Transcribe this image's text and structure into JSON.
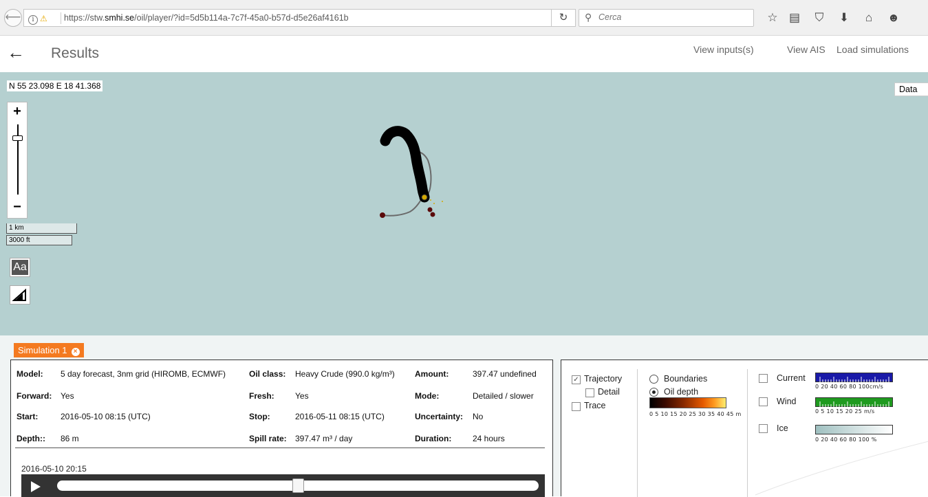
{
  "browser": {
    "url_prefix": "https://stw.",
    "url_domain": "smhi.se",
    "url_path": "/oil/player/?id=5d5b114a-7c7f-45a0-b57d-d5e26af4161b",
    "search_placeholder": "Cerca",
    "icons": [
      "back-icon",
      "info-icon",
      "warning-lock-icon",
      "reload-icon",
      "search-icon",
      "star-icon",
      "reading-list-icon",
      "pocket-icon",
      "download-icon",
      "home-icon",
      "smiley-icon"
    ]
  },
  "header": {
    "title": "Results",
    "links": [
      "View inputs(s)",
      "View AIS",
      "Load simulations"
    ]
  },
  "map": {
    "coordinates": "N 55 23.098 E 18 41.368",
    "zoom_in": "+",
    "zoom_out": "−",
    "scale_km": "1 km",
    "scale_ft": "3000 ft",
    "font_tool": "Aa",
    "data_dropdown": "Data"
  },
  "simulation": {
    "tab_label": "Simulation 1",
    "close": "×",
    "rows": [
      [
        {
          "label": "Model:",
          "value": "5 day forecast, 3nm grid (HIROMB, ECMWF)"
        },
        {
          "label": "Oil class:",
          "value": "Heavy Crude (990.0 kg/m³)"
        },
        {
          "label": "Amount:",
          "value": "397.47 undefined"
        }
      ],
      [
        {
          "label": "Forward:",
          "value": "Yes"
        },
        {
          "label": "Fresh:",
          "value": "Yes"
        },
        {
          "label": "Mode:",
          "value": "Detailed / slower"
        }
      ],
      [
        {
          "label": "Start:",
          "value": "2016-05-10 08:15 (UTC)"
        },
        {
          "label": "Stop:",
          "value": "2016-05-11 08:15 (UTC)"
        },
        {
          "label": "Uncertainty:",
          "value": "No"
        }
      ],
      [
        {
          "label": "Depth::",
          "value": "86 m"
        },
        {
          "label": "Spill rate:",
          "value": "397.47 m³ / day"
        },
        {
          "label": "Duration:",
          "value": "24 hours"
        }
      ]
    ],
    "current_time": "2016-05-10 20:15",
    "slider_position": 0.5
  },
  "layers": {
    "trajectory": {
      "label": "Trajectory",
      "checked": true
    },
    "detail": {
      "label": "Detail",
      "checked": false
    },
    "trace": {
      "label": "Trace",
      "checked": false
    },
    "boundaries": {
      "label": "Boundaries",
      "selected": false
    },
    "oil_depth": {
      "label": "Oil depth",
      "selected": true
    },
    "oil_depth_scale": "0 5 10 15 20 25 30 35 40 45 m",
    "current": {
      "label": "Current",
      "checked": false,
      "scale": "0  20  40  60  80  100cm/s",
      "color": "#1a1aa8"
    },
    "wind": {
      "label": "Wind",
      "checked": false,
      "scale": "0   5   10  15  20  25  m/s",
      "color": "#1f9a1f"
    },
    "ice": {
      "label": "Ice",
      "checked": false,
      "scale": "0  20  40  60  80  100 %",
      "color": "#9fc0c0"
    }
  }
}
